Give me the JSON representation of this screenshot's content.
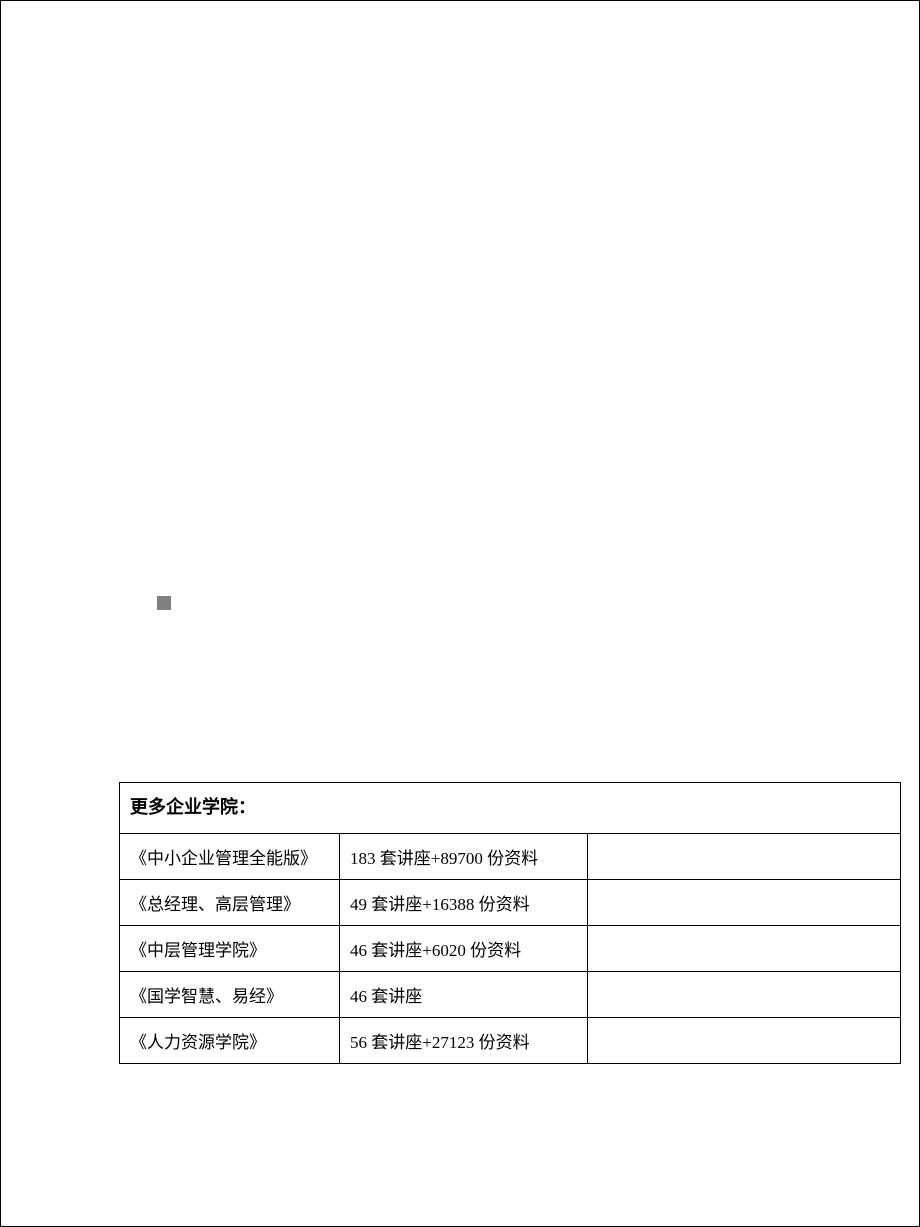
{
  "table": {
    "header": "更多企业学院：",
    "rows": [
      {
        "name": "《中小企业管理全能版》",
        "detail": "183 套讲座+89700 份资料",
        "extra": ""
      },
      {
        "name": "《总经理、高层管理》",
        "detail": "49 套讲座+16388 份资料",
        "extra": ""
      },
      {
        "name": "《中层管理学院》",
        "detail": "46 套讲座+6020 份资料",
        "extra": ""
      },
      {
        "name": "《国学智慧、易经》",
        "detail": "46 套讲座",
        "extra": ""
      },
      {
        "name": "《人力资源学院》",
        "detail": "56 套讲座+27123 份资料",
        "extra": ""
      }
    ]
  }
}
